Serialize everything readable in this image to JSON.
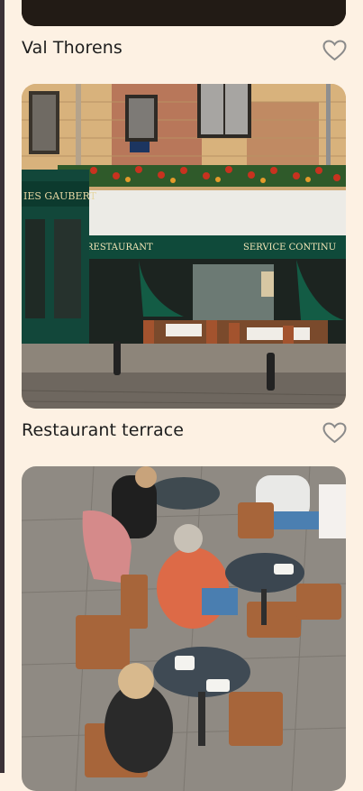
{
  "cards": [
    {
      "title": "Val Thorens",
      "favorite": false,
      "image": "val-thorens-photo"
    },
    {
      "title": "Restaurant terrace",
      "favorite": false,
      "image": "restaurant-terrace-photo"
    },
    {
      "title": "",
      "favorite": false,
      "image": "cafe-tables-photo"
    }
  ],
  "icons": {
    "favorite": "heart-outline-icon"
  },
  "colors": {
    "background": "#fdf1e3",
    "text": "#1d1d1d",
    "icon": "#8a8a8a",
    "awning": "#0f4a3a"
  },
  "sign": {
    "left_text": "RESTAURANT",
    "right_text": "SERVICE CONTINU",
    "shop_text": "IES GAUBERT"
  }
}
